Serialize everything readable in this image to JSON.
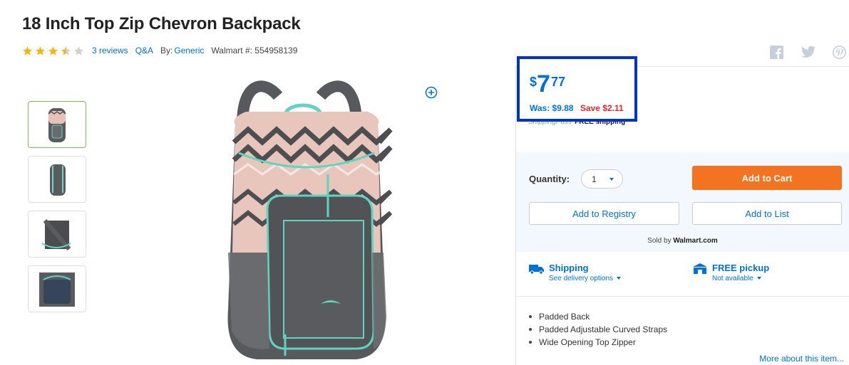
{
  "product": {
    "title": "18 Inch Top Zip Chevron Backpack",
    "rating_stars": 3.5,
    "reviews_link": "3 reviews",
    "qa_link": "Q&A",
    "by_label": "By:",
    "brand": "Generic",
    "walmart_number": "Walmart #: 554958139"
  },
  "price": {
    "currency": "$",
    "dollars": "7",
    "cents": "77",
    "was": "Was: $9.88",
    "save": "Save $2.11"
  },
  "shipping_pass": {
    "label": "ShippingPass",
    "free_shipping": "FREE shipping"
  },
  "cart": {
    "quantity_label": "Quantity:",
    "quantity_value": "1",
    "add_to_cart": "Add to Cart",
    "add_to_registry": "Add to Registry",
    "add_to_list": "Add to List",
    "sold_by_prefix": "Sold by",
    "seller": "Walmart.com"
  },
  "fulfillment": {
    "shipping_title": "Shipping",
    "shipping_sub": "See delivery options",
    "pickup_title": "FREE pickup",
    "pickup_sub": "Not available"
  },
  "features": [
    "Padded Back",
    "Padded Adjustable Curved Straps",
    "Wide Opening Top Zipper"
  ],
  "more_link": "More about this item...",
  "colors": {
    "brand_blue": "#0071dc",
    "cart_orange": "#f47321",
    "save_red": "#e4262c",
    "star_gold": "#f9b413",
    "highlight_box": "#0033cc"
  },
  "icons": {
    "social": [
      "facebook-icon",
      "twitter-icon",
      "pinterest-icon"
    ],
    "zoom": "zoom-in-icon",
    "shipping": "truck-icon",
    "pickup": "store-icon"
  }
}
